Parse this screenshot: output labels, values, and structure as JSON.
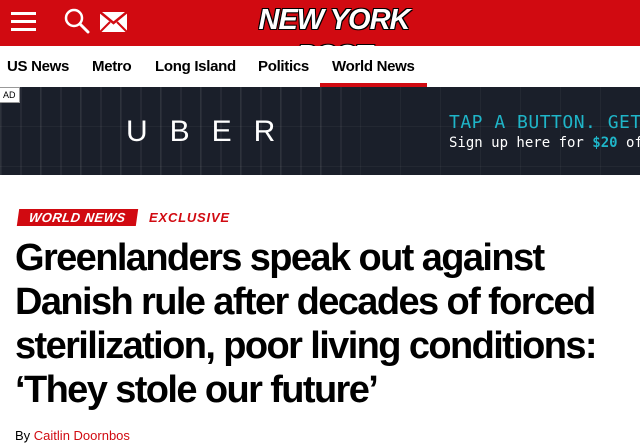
{
  "header": {
    "logo_text": "NEW YORK POST",
    "menu_icon": "hamburger-menu-icon",
    "search_icon": "search-icon",
    "mail_icon": "mail-icon",
    "brand_color": "#d10a11"
  },
  "nav": {
    "items": [
      {
        "label": "US News"
      },
      {
        "label": "Metro"
      },
      {
        "label": "Long Island"
      },
      {
        "label": "Politics"
      },
      {
        "label": "World News",
        "active": true
      }
    ]
  },
  "ad": {
    "label": "AD",
    "brand": "UBER",
    "tagline": "TAP A BUTTON. GET A",
    "sub_prefix": "Sign up here for ",
    "sub_amount": "$20",
    "sub_suffix": " off yo"
  },
  "article": {
    "section": "WORLD NEWS",
    "label": "EXCLUSIVE",
    "headline": "Greenlanders speak out against Danish rule after decades of forced sterilization, poor living conditions: ‘They stole our future’",
    "byline_prefix": "By ",
    "author": "Caitlin Doornbos"
  }
}
